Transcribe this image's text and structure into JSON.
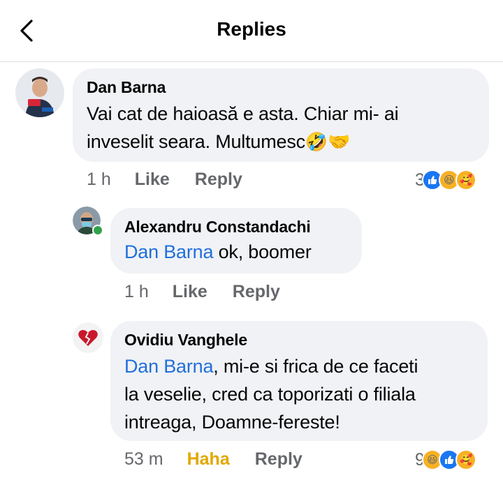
{
  "header": {
    "title": "Replies"
  },
  "icons": {
    "back": "chevron-left-icon",
    "like": "like-icon",
    "haha": "haha-icon",
    "care": "care-icon"
  },
  "colors": {
    "mention": "#216fdb",
    "haha": "#e0a800",
    "like_blue": "#1877f2",
    "bubble": "#f0f2f5"
  },
  "comments": [
    {
      "author": "Dan Barna",
      "text_line1": "Vai cat de haioasă e asta. Chiar mi- ai",
      "text_line2": "inveselit seara. Multumesc",
      "emojis": "🤣🤝",
      "time": "1 h",
      "like": "Like",
      "reply": "Reply",
      "reactions_count": "3"
    },
    {
      "author": "Alexandru Constandachi",
      "mention": "Dan Barna",
      "text": " ok, boomer",
      "time": "1 h",
      "like": "Like",
      "reply": "Reply"
    },
    {
      "author": "Ovidiu Vanghele",
      "mention": "Dan Barna",
      "text_line1": ", mi-e si frica de ce faceti",
      "text_line2": "la veselie, cred ca toporizati o filiala",
      "text_line3": "intreaga, Doamne-fereste!",
      "time": "53 m",
      "haha": "Haha",
      "reply": "Reply",
      "reactions_count": "9"
    }
  ]
}
